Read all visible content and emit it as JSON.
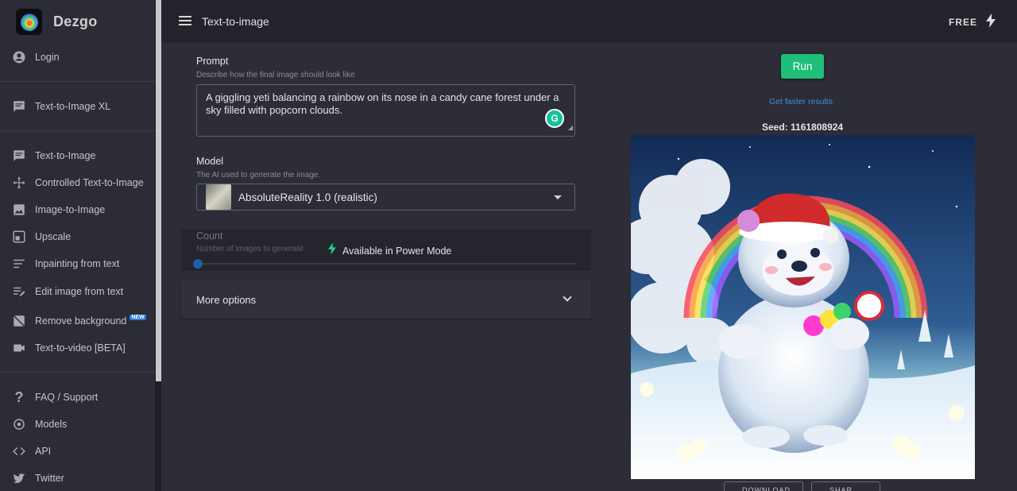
{
  "sidebar": {
    "brand": "Dezgo",
    "login": "Login",
    "group1": [
      {
        "label": "Text-to-Image XL",
        "icon": "chat-bubble-icon"
      }
    ],
    "group2": [
      {
        "label": "Text-to-Image",
        "icon": "chat-bubble-icon"
      },
      {
        "label": "Controlled Text-to-Image",
        "icon": "move-arrows-icon"
      },
      {
        "label": "Image-to-Image",
        "icon": "image-icon"
      },
      {
        "label": "Upscale",
        "icon": "upscale-icon"
      },
      {
        "label": "Inpainting from text",
        "icon": "lines-icon"
      },
      {
        "label": "Edit image from text",
        "icon": "edit-lines-icon"
      },
      {
        "label": "Remove background",
        "icon": "image-off-icon",
        "badge": "NEW"
      },
      {
        "label": "Text-to-video [BETA]",
        "icon": "video-camera-icon"
      }
    ],
    "group3": [
      {
        "label": "FAQ / Support",
        "icon": "question-icon"
      },
      {
        "label": "Models",
        "icon": "models-icon"
      },
      {
        "label": "API",
        "icon": "code-icon"
      },
      {
        "label": "Twitter",
        "icon": "twitter-icon"
      }
    ]
  },
  "topbar": {
    "title": "Text-to-image",
    "plan": "FREE"
  },
  "form": {
    "prompt_label": "Prompt",
    "prompt_help": "Describe how the final image should look like",
    "prompt_value": "A giggling yeti balancing a rainbow on its nose in a candy cane forest under a sky filled with popcorn clouds.",
    "model_label": "Model",
    "model_help": "The AI used to generate the image.",
    "model_value": "AbsoluteReality 1.0 (realistic)",
    "count_label": "Count",
    "count_help": "Number of images to generate",
    "power_mode": "Available in Power Mode",
    "more_options": "More options"
  },
  "result": {
    "run_label": "Run",
    "faster_link": "Get faster results",
    "seed_text": "Seed: 1161808924",
    "download_label": "DOWNLOAD",
    "share_label": "SHAR"
  },
  "colors": {
    "accent": "#1fbe79",
    "link": "#3f8fe0",
    "sidebar_bg": "#2b2c35",
    "topbar_bg": "#22232b"
  }
}
